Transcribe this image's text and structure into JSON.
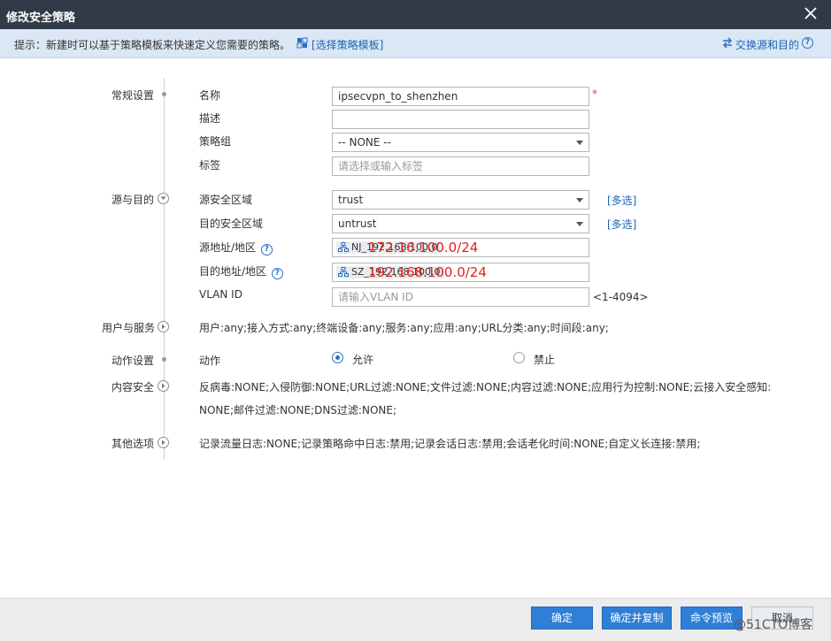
{
  "dialog": {
    "title": "修改安全策略"
  },
  "tip": {
    "text": "提示：新建时可以基于策略模板来快速定义您需要的策略。",
    "template_link": "[选择策略模板]",
    "swap_link": "交换源和目的",
    "help_glyph": "?"
  },
  "sections": {
    "general": "常规设置",
    "source_dest": "源与目的",
    "user_service": "用户与服务",
    "action": "动作设置",
    "content": "内容安全",
    "other": "其他选项"
  },
  "general": {
    "name_label": "名称",
    "name_value": "ipsecvpn_to_shenzhen",
    "required_mark": "*",
    "desc_label": "描述",
    "desc_value": "",
    "group_label": "策略组",
    "group_value": "-- NONE --",
    "tag_label": "标签",
    "tag_placeholder": "请选择或输入标签"
  },
  "source_dest": {
    "src_zone_label": "源安全区域",
    "src_zone_value": "trust",
    "dst_zone_label": "目的安全区域",
    "dst_zone_value": "untrust",
    "multi_link": "[多选]",
    "src_addr_label": "源地址/地区",
    "src_addr_chip": "NJ_192.168.100.0",
    "src_addr_annotation": "172.16.100.0/24",
    "dst_addr_label": "目的地址/地区",
    "dst_addr_chip": "SZ_192.168.100.0",
    "dst_addr_annotation": "192.168.100.0/24",
    "help_glyph": "?",
    "vlan_label": "VLAN ID",
    "vlan_placeholder": "请输入VLAN ID",
    "vlan_range": "<1-4094>"
  },
  "user_service": {
    "summary": "用户:any;接入方式:any;终端设备:any;服务:any;应用:any;URL分类:any;时间段:any;"
  },
  "action": {
    "label": "动作",
    "allow": "允许",
    "deny": "禁止",
    "selected": "allow"
  },
  "content": {
    "line1": "反病毒:NONE;入侵防御:NONE;URL过滤:NONE;文件过滤:NONE;内容过滤:NONE;应用行为控制:NONE;云接入安全感知:",
    "line2": "NONE;邮件过滤:NONE;DNS过滤:NONE;"
  },
  "other": {
    "summary": "记录流量日志:NONE;记录策略命中日志:禁用;记录会话日志:禁用;会话老化时间:NONE;自定义长连接:禁用;"
  },
  "buttons": {
    "ok": "确定",
    "ok_copy": "确定并复制",
    "preview": "命令预览",
    "cancel": "取消"
  },
  "watermark": "@51CTO博客",
  "colors": {
    "titlebar": "#313a46",
    "tipbar": "#dbe7f4",
    "link": "#1a64b8",
    "primary_button": "#2f7fd6",
    "annotation_red": "#e0201a"
  }
}
